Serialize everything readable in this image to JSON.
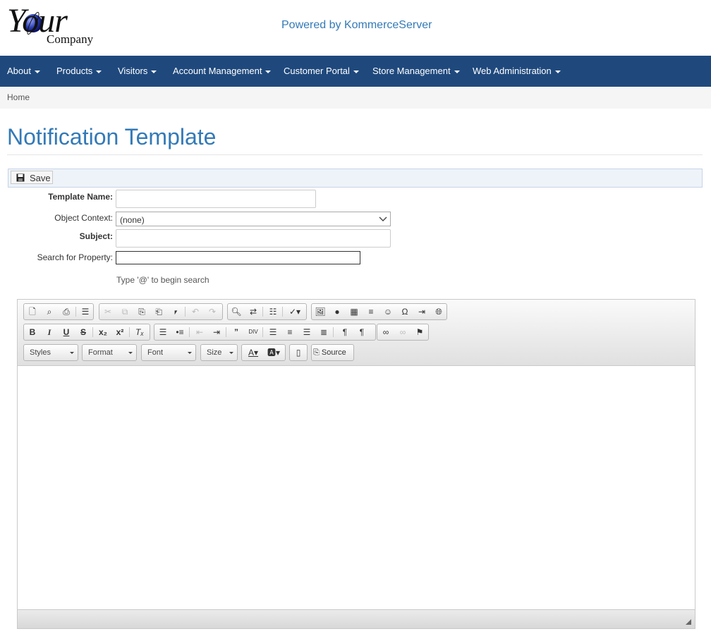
{
  "header": {
    "logo": {
      "your": "Your",
      "company": "Company"
    },
    "powered_by": "Powered by KommerceServer"
  },
  "nav": {
    "items": [
      {
        "label": "About"
      },
      {
        "label": "Products"
      },
      {
        "label": "Visitors"
      },
      {
        "label": "Account Management"
      },
      {
        "label": "Customer Portal"
      },
      {
        "label": "Store Management"
      },
      {
        "label": "Web Administration"
      }
    ]
  },
  "breadcrumb": {
    "home": "Home"
  },
  "page": {
    "title": "Notification Template"
  },
  "toolbar": {
    "save_label": "Save"
  },
  "form": {
    "template_name": {
      "label": "Template Name:",
      "value": ""
    },
    "object_context": {
      "label": "Object Context:",
      "selected": "(none)"
    },
    "subject": {
      "label": "Subject:",
      "value": ""
    },
    "search_property": {
      "label": "Search for Property:",
      "value": ""
    },
    "hint": "Type '@' to begin search"
  },
  "editor": {
    "combos": {
      "styles": "Styles",
      "format": "Format",
      "font": "Font",
      "size": "Size"
    },
    "source_label": "Source"
  },
  "colors": {
    "nav_bg": "#1f497d",
    "accent": "#337ab7"
  }
}
